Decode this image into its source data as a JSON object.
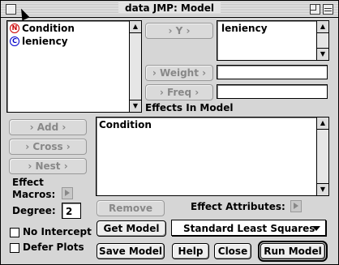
{
  "window": {
    "title": "data JMP: Model"
  },
  "columns": {
    "items": [
      {
        "label": "Condition",
        "badge": "N"
      },
      {
        "label": "leniency",
        "badge": "C"
      }
    ]
  },
  "roles": {
    "y_button": "› Y ›",
    "y_value": "leniency",
    "weight_button": "› Weight ›",
    "weight_value": "",
    "freq_button": "› Freq ›",
    "freq_value": ""
  },
  "effects": {
    "header": "Effects In Model",
    "items": [
      "Condition"
    ],
    "add_button": "› Add ›",
    "cross_button": "› Cross ›",
    "nest_button": "› Nest ›",
    "macros_label_1": "Effect",
    "macros_label_2": "Macros:",
    "degree_label": "Degree:",
    "degree_value": "2",
    "remove_button": "Remove",
    "attributes_label": "Effect Attributes:"
  },
  "options": {
    "no_intercept": "No Intercept",
    "defer_plots": "Defer Plots"
  },
  "actions": {
    "get_model": "Get Model",
    "personality": "Standard Least Squares",
    "save_model": "Save Model",
    "help": "Help",
    "close": "Close",
    "run_model": "Run Model"
  },
  "colors": {
    "nominal_badge": "#cc0000",
    "continuous_badge": "#0000cc"
  },
  "icons": [
    "close-box-icon",
    "zoom-box-icon",
    "collapse-box-icon",
    "scroll-up-icon",
    "scroll-down-icon",
    "disclosure-triangle-icon",
    "dropdown-arrow-icon",
    "mouse-cursor-icon"
  ]
}
